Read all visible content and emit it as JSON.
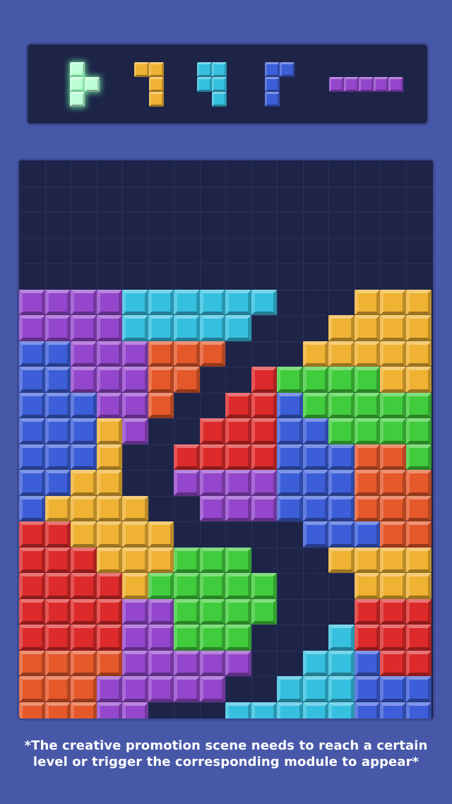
{
  "colors": {
    "P": "#9446cc",
    "C": "#35c0e0",
    "Y": "#f0b232",
    "B": "#3c5ed8",
    "O": "#e5582a",
    "R": "#dd2a2a",
    "G": "#40cc3c",
    "W": "#bfffd8"
  },
  "preview_pieces": [
    {
      "name": "next-piece-1",
      "color": "W",
      "shape": [
        "X.",
        "XX",
        "X."
      ]
    },
    {
      "name": "next-piece-2",
      "color": "Y",
      "shape": [
        "XX",
        ".X",
        ".X"
      ]
    },
    {
      "name": "next-piece-3",
      "color": "C",
      "shape": [
        "XX",
        "XX",
        ".X"
      ]
    },
    {
      "name": "next-piece-4",
      "color": "B",
      "shape": [
        "XX",
        "X.",
        "X."
      ]
    },
    {
      "name": "next-piece-5",
      "color": "P",
      "shape": [
        "XXXXX"
      ]
    }
  ],
  "board": {
    "columns": 16,
    "rows": 22,
    "cells": [
      "................",
      "................",
      "................",
      "................",
      "................",
      "PPPPCCCCCC...YYYY",
      "PPPPCCCCC...YYYYY",
      "BBPPPOOO...YYYYYY",
      "BBPPPOO..RGGGGYY",
      "BBBPPO..RRBGGGGG",
      "BBBYP..RRRBBGGGG",
      "BBBY..RRRRBBBOOG",
      "BBYY..PPPPBBBOOO",
      "BYYYY..PPPBBBOOO",
      "RRYYYY.....BBBOOO",
      "RRRYYYGGG...YYYYY",
      "RRRRYGGGGG...YYYY",
      "RRRRPPGGGG...RRRR",
      "RRRRPPGGG...CRRRR",
      "OOOOPPPPP..CCBRRB",
      "OOOPPPPP..CCCBBBB",
      "OOOPP...CCCCCBBBB"
    ]
  },
  "footnote": "*The creative promotion scene needs to reach a certain level or trigger the corresponding module to appear*"
}
